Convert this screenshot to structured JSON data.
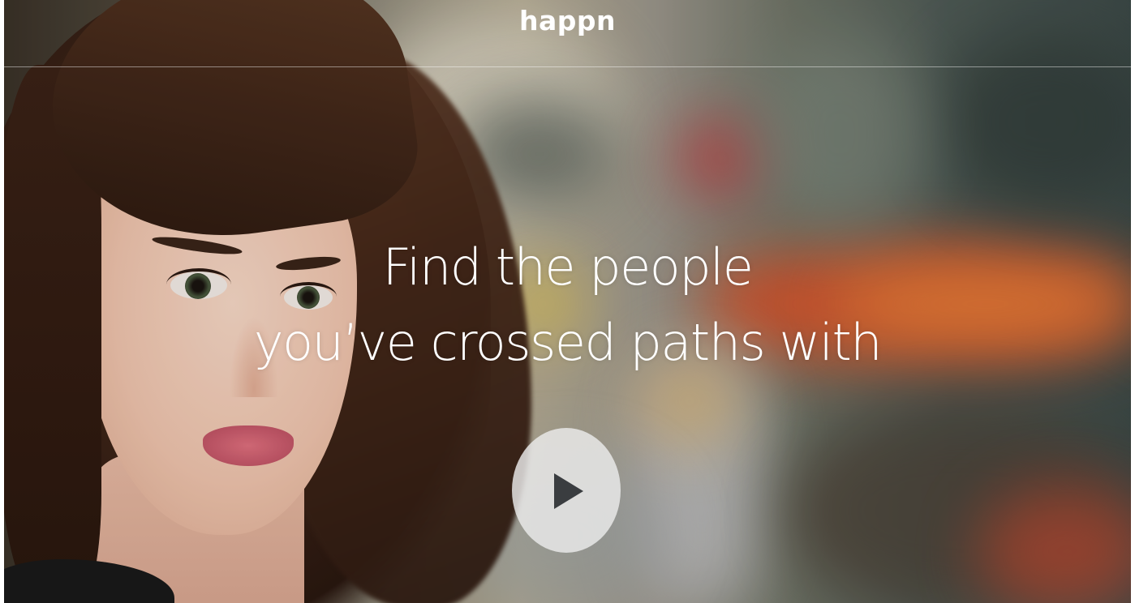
{
  "header": {
    "logo_text": "happn"
  },
  "hero": {
    "headline_line1": "Find the people",
    "headline_line2": "you’ve crossed paths with",
    "play_button_icon": "play-icon"
  },
  "colors": {
    "text": "#ffffff",
    "play_button_bg": "#ebebeb",
    "play_icon": "#3a3d40"
  }
}
